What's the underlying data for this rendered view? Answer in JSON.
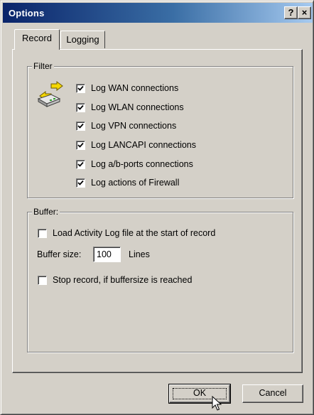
{
  "window": {
    "title": "Options",
    "help_label": "?",
    "close_label": "×"
  },
  "tabs": [
    {
      "label": "Record",
      "selected": true
    },
    {
      "label": "Logging",
      "selected": false
    }
  ],
  "filter": {
    "legend": "Filter",
    "icon": "network-connection-icon",
    "items": [
      {
        "label": "Log WAN connections",
        "checked": true
      },
      {
        "label": "Log WLAN connections",
        "checked": true
      },
      {
        "label": "Log VPN connections",
        "checked": true
      },
      {
        "label": "Log LANCAPI connections",
        "checked": true
      },
      {
        "label": "Log a/b-ports connections",
        "checked": true
      },
      {
        "label": "Log actions of Firewall",
        "checked": true
      }
    ]
  },
  "buffer": {
    "legend": "Buffer:",
    "load_activity_log": {
      "label": "Load Activity Log file at the start of record",
      "checked": false
    },
    "buffer_size_label": "Buffer size:",
    "buffer_size_value": "100",
    "buffer_size_unit": "Lines",
    "stop_record": {
      "label": "Stop record, if buffersize is reached",
      "checked": false
    }
  },
  "buttons": {
    "ok_label": "OK",
    "cancel_label": "Cancel"
  },
  "colors": {
    "face": "#d4d0c8",
    "title_start": "#0a246a",
    "title_end": "#a6caf0"
  }
}
